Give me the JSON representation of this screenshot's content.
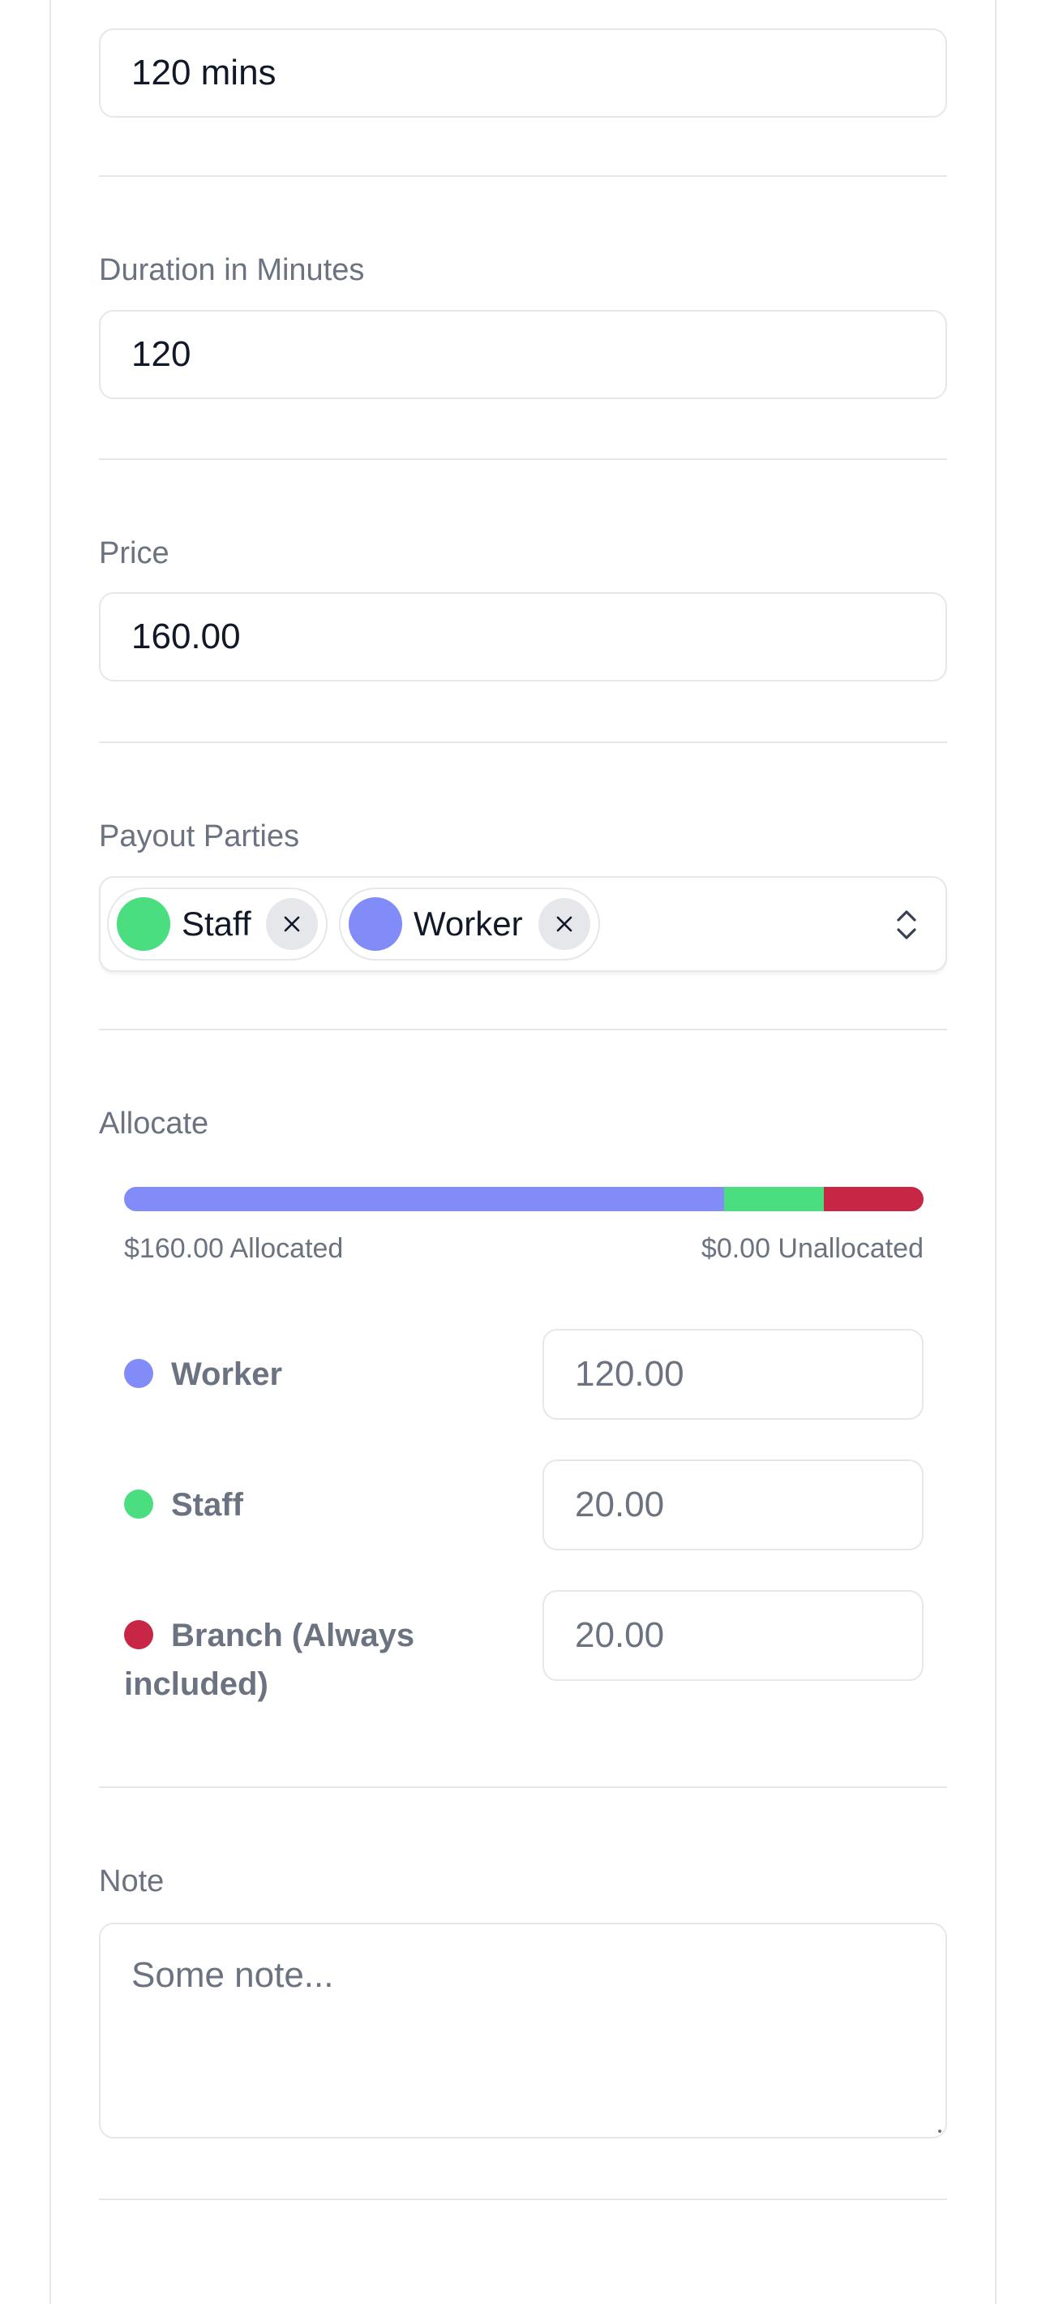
{
  "fields": {
    "duration_label_text": {
      "value": "120 mins"
    },
    "duration_minutes": {
      "label": "Duration in Minutes",
      "value": "120"
    },
    "price": {
      "label": "Price",
      "value": "160.00"
    },
    "payout_parties": {
      "label": "Payout Parties",
      "chips": [
        {
          "label": "Staff",
          "color": "#4ade80"
        },
        {
          "label": "Worker",
          "color": "#818cf8"
        }
      ]
    },
    "allocate": {
      "label": "Allocate",
      "allocated_text": "$160.00 Allocated",
      "unallocated_text": "$0.00 Unallocated",
      "bar": [
        {
          "party": "Worker",
          "fraction": 0.75,
          "color": "#818cf8"
        },
        {
          "party": "Staff",
          "fraction": 0.125,
          "color": "#4ade80"
        },
        {
          "party": "Branch",
          "fraction": 0.125,
          "color": "#c72645"
        }
      ],
      "rows": [
        {
          "name": "Worker",
          "amount": "120.00",
          "color": "#818cf8"
        },
        {
          "name": "Staff",
          "amount": "20.00",
          "color": "#4ade80"
        },
        {
          "name": "Branch (Always included)",
          "amount": "20.00",
          "color": "#c72645"
        }
      ]
    },
    "note": {
      "label": "Note",
      "placeholder": "Some note..."
    }
  }
}
